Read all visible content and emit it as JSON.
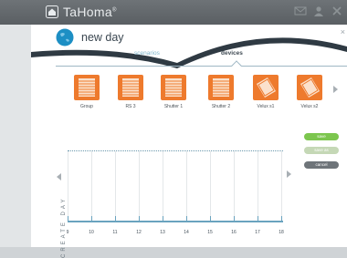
{
  "header": {
    "app_name": "TaHoma",
    "app_mark": "®"
  },
  "dialog": {
    "title": "new day",
    "close_symbol": "×"
  },
  "tabs": [
    {
      "label": "scenarios",
      "active": false
    },
    {
      "label": "devices",
      "active": true
    }
  ],
  "devices": [
    {
      "label": "Group",
      "type": "shutter"
    },
    {
      "label": "RS 3",
      "type": "shutter"
    },
    {
      "label": "Shutter 1",
      "type": "shutter"
    },
    {
      "label": "Shutter 2",
      "type": "shutter"
    },
    {
      "label": "Velux s1",
      "type": "window"
    },
    {
      "label": "Velux s2",
      "type": "window"
    }
  ],
  "side_label": "CREATE DAY",
  "timeline": {
    "hours": [
      "9",
      "10",
      "11",
      "12",
      "13",
      "14",
      "15",
      "16",
      "17",
      "18"
    ]
  },
  "buttons": {
    "save": "save",
    "save_as": "save as",
    "cancel": "cancel"
  },
  "colors": {
    "accent_orange": "#ee7a2d",
    "accent_blue": "#1d8fc4",
    "save_green": "#7cc64e",
    "header_gray": "#62676b"
  }
}
